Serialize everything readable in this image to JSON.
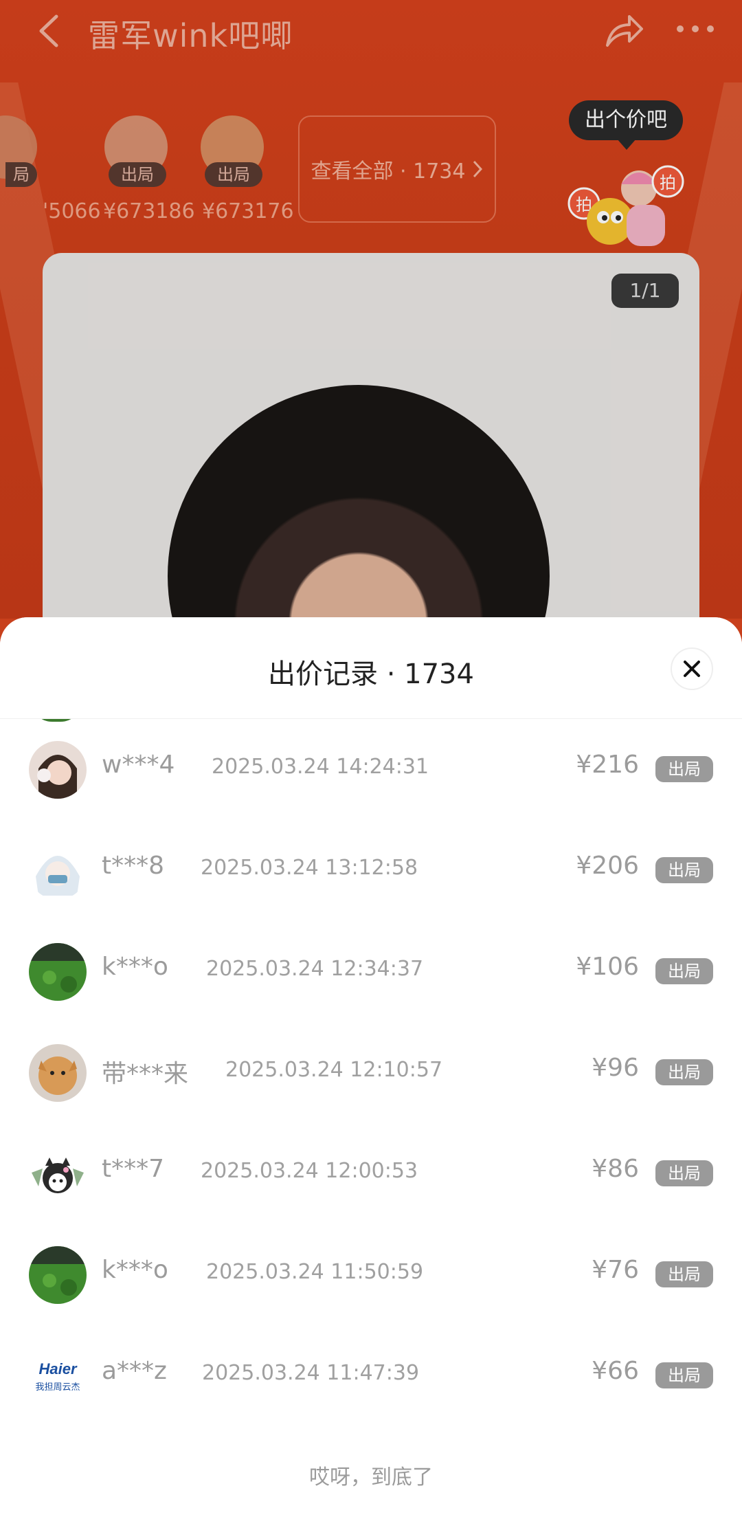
{
  "topbar": {
    "title": "雷军wink吧唧"
  },
  "bidder_strip": [
    {
      "badge": "局",
      "price": "'5066"
    },
    {
      "badge": "出局",
      "price": "¥673186"
    },
    {
      "badge": "出局",
      "price": "¥673176"
    }
  ],
  "view_all": {
    "label": "查看全部 · 1734"
  },
  "bid_bubble": {
    "label": "出个价吧"
  },
  "mascot_labels": [
    "拍",
    "拍"
  ],
  "product": {
    "counter": "1/1"
  },
  "sheet": {
    "title": "出价记录 · 1734",
    "rows": [
      {
        "user": "w***4",
        "time": "2025.03.24 14:24:31",
        "price": "¥216",
        "status": "出局",
        "avatar": "girl"
      },
      {
        "user": "t***8",
        "time": "2025.03.24 13:12:58",
        "price": "¥206",
        "status": "出局",
        "avatar": "anime"
      },
      {
        "user": "k***o",
        "time": "2025.03.24 12:34:37",
        "price": "¥106",
        "status": "出局",
        "avatar": "grass"
      },
      {
        "user": "带***来",
        "time": "2025.03.24 12:10:57",
        "price": "¥96",
        "status": "出局",
        "avatar": "cat"
      },
      {
        "user": "t***7",
        "time": "2025.03.24 12:00:53",
        "price": "¥86",
        "status": "出局",
        "avatar": "kuromi"
      },
      {
        "user": "k***o",
        "time": "2025.03.24 11:50:59",
        "price": "¥76",
        "status": "出局",
        "avatar": "grass"
      },
      {
        "user": "a***z",
        "time": "2025.03.24 11:47:39",
        "price": "¥66",
        "status": "出局",
        "avatar": "haier"
      }
    ],
    "haier": {
      "brand": "Haier",
      "slogan": "我担周云杰"
    },
    "footer": "哎呀，到底了"
  }
}
